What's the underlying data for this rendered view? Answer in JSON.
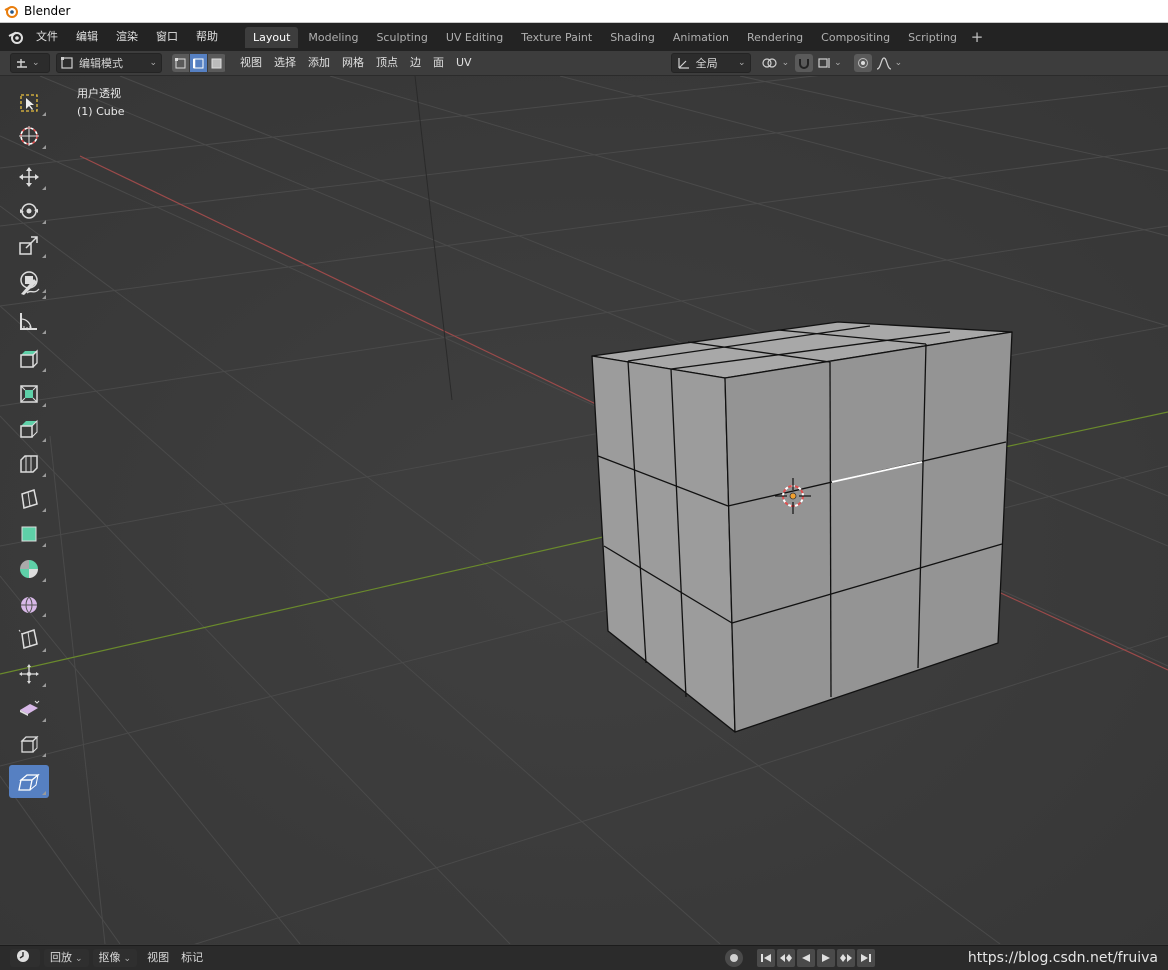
{
  "window": {
    "title": "Blender"
  },
  "menus": [
    "文件",
    "编辑",
    "渲染",
    "窗口",
    "帮助"
  ],
  "workspaces": [
    "Layout",
    "Modeling",
    "Sculpting",
    "UV Editing",
    "Texture Paint",
    "Shading",
    "Animation",
    "Rendering",
    "Compositing",
    "Scripting"
  ],
  "active_workspace": "Layout",
  "header": {
    "mode": "编辑模式",
    "menus": [
      "视图",
      "选择",
      "添加",
      "网格",
      "顶点",
      "边",
      "面",
      "UV"
    ],
    "orientation": "全局",
    "select_mode_active": "edge"
  },
  "viewport": {
    "view_label": "用户透视",
    "object_label": "(1) Cube"
  },
  "tools": [
    {
      "name": "select-box",
      "active": false
    },
    {
      "name": "cursor",
      "active": false
    },
    {
      "name": "move",
      "active": false
    },
    {
      "name": "rotate",
      "active": false
    },
    {
      "name": "scale",
      "active": false
    },
    {
      "name": "transform",
      "active": false
    },
    {
      "name": "annotate",
      "active": false
    },
    {
      "name": "measure",
      "active": false
    },
    {
      "name": "add-cube",
      "active": false
    },
    {
      "name": "extrude-region",
      "active": false
    },
    {
      "name": "inset-faces",
      "active": false
    },
    {
      "name": "bevel",
      "active": false
    },
    {
      "name": "loop-cut",
      "active": false
    },
    {
      "name": "knife",
      "active": false
    },
    {
      "name": "poly-build",
      "active": false
    },
    {
      "name": "spin",
      "active": false
    },
    {
      "name": "smooth",
      "active": false
    },
    {
      "name": "edge-slide",
      "active": false
    },
    {
      "name": "shrink-fatten",
      "active": false
    },
    {
      "name": "shear",
      "active": false
    },
    {
      "name": "rip-region",
      "active": true
    }
  ],
  "timeline": {
    "menus": [
      "回放",
      "抠像",
      "视图",
      "标记"
    ]
  },
  "watermark": "https://blog.csdn.net/fruiva",
  "colors": {
    "accent": "#5680c2",
    "x_axis": "#b04848",
    "y_axis": "#6e8f2e",
    "mesh_face": "#9a9a9a",
    "selected_edge": "#ffffff"
  }
}
